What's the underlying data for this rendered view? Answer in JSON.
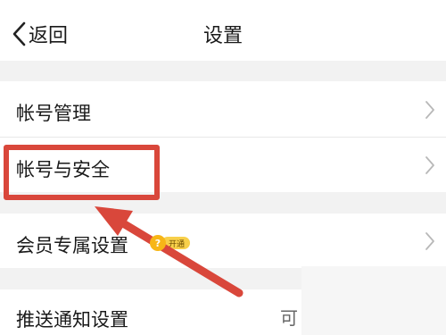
{
  "header": {
    "back_label": "返回",
    "title": "设置"
  },
  "settings": {
    "items": [
      {
        "label": "帐号管理"
      },
      {
        "label": "帐号与安全"
      },
      {
        "label": "会员专属设置",
        "badge": {
          "coin_glyph": "?",
          "text": "开通"
        }
      },
      {
        "label": "推送通知设置",
        "trailing": "可"
      }
    ]
  },
  "colors": {
    "page_background": "#ffffff",
    "section_gap": "#f2f2f2",
    "annotation_red": "#d9473b",
    "badge_gold": "#f8d04a",
    "chevron": "#b8b8b8"
  },
  "icons": [
    "back-chevron-icon",
    "chevron-right-icon",
    "vip-coin-icon"
  ]
}
